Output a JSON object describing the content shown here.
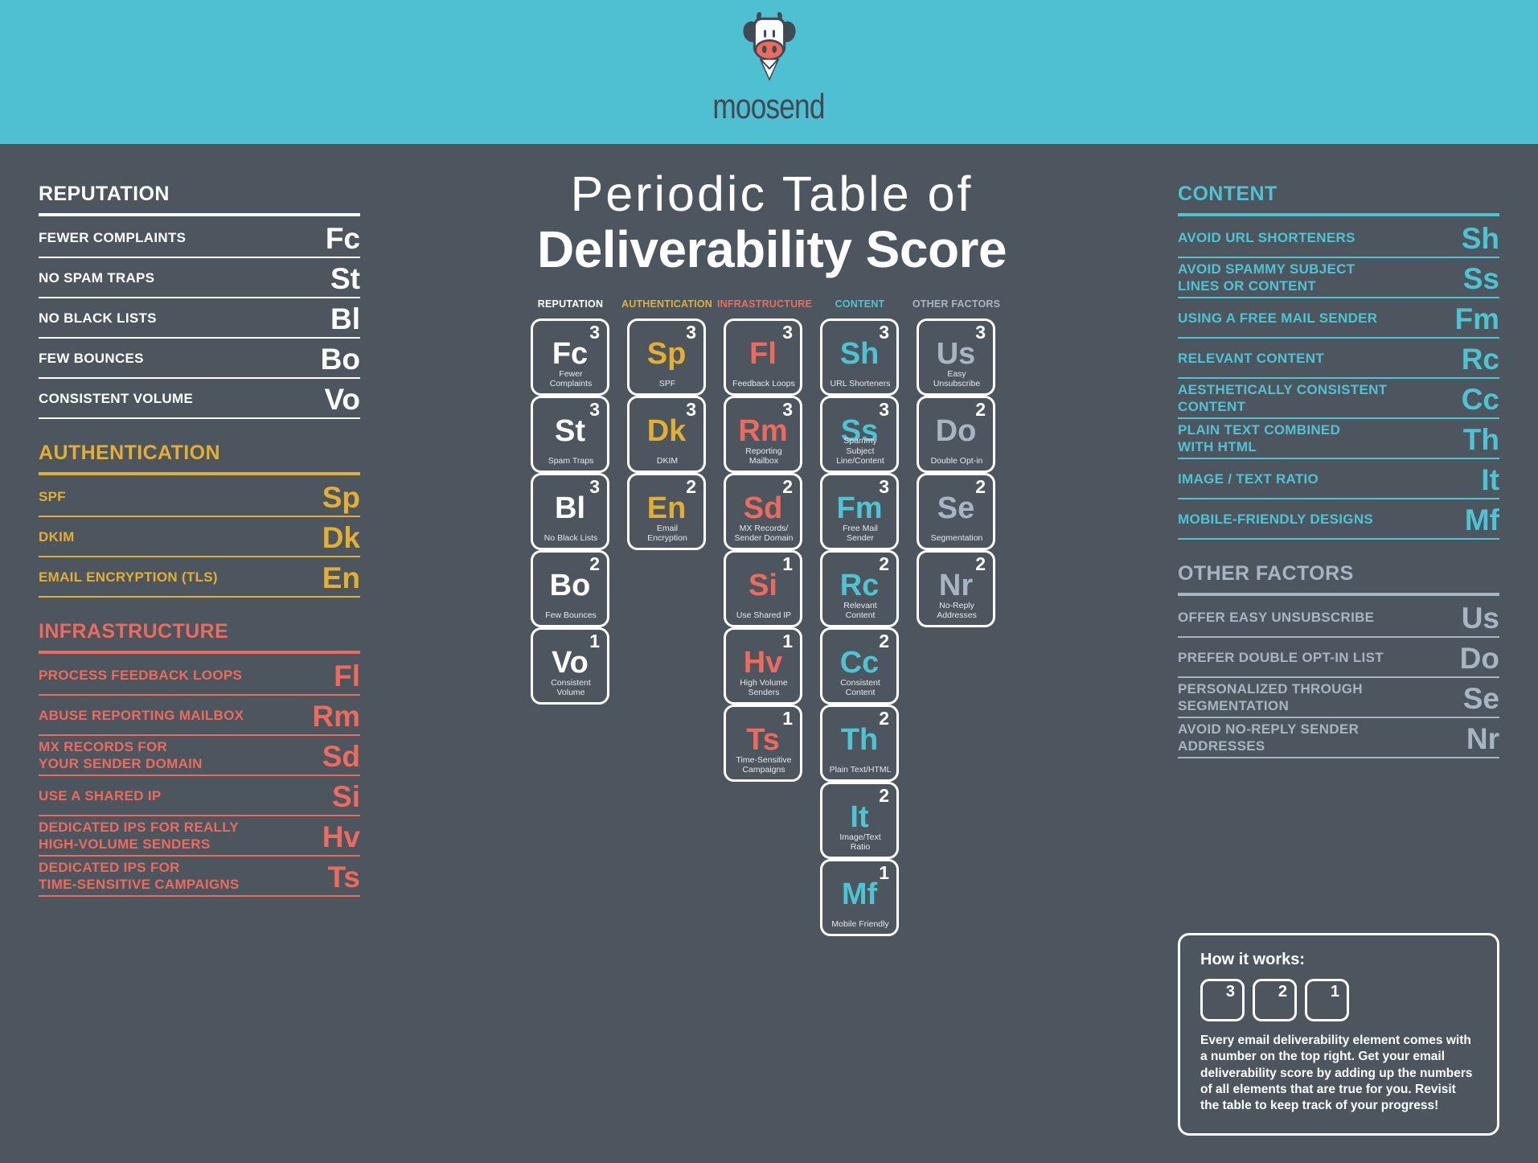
{
  "brand": {
    "name": "moosend",
    "header_bg": "#4fbfd2",
    "page_bg": "#4d565f"
  },
  "title": {
    "line1": "Periodic Table of",
    "line2": "Deliverability Score"
  },
  "colors": {
    "reputation": "#ffffff",
    "authentication": "#e3ae34",
    "infrastructure": "#ec6a5e",
    "content": "#4fc3d2",
    "other_factors": "#a7b4c2"
  },
  "left_sections": [
    {
      "heading": "REPUTATION",
      "color_key": "reputation",
      "rows": [
        {
          "label": "FEWER COMPLAINTS",
          "symbol": "Fc"
        },
        {
          "label": "NO SPAM TRAPS",
          "symbol": "St"
        },
        {
          "label": "NO BLACK LISTS",
          "symbol": "Bl"
        },
        {
          "label": "FEW BOUNCES",
          "symbol": "Bo"
        },
        {
          "label": "CONSISTENT VOLUME",
          "symbol": "Vo"
        }
      ]
    },
    {
      "heading": "AUTHENTICATION",
      "color_key": "authentication",
      "rows": [
        {
          "label": "SPF",
          "symbol": "Sp"
        },
        {
          "label": "DKIM",
          "symbol": "Dk"
        },
        {
          "label": "EMAIL ENCRYPTION (TLS)",
          "symbol": "En"
        }
      ]
    },
    {
      "heading": "INFRASTRUCTURE",
      "color_key": "infrastructure",
      "rows": [
        {
          "label": "PROCESS FEEDBACK LOOPS",
          "symbol": "Fl"
        },
        {
          "label": "ABUSE REPORTING MAILBOX",
          "symbol": "Rm"
        },
        {
          "label": "MX RECORDS FOR\nYOUR SENDER DOMAIN",
          "symbol": "Sd"
        },
        {
          "label": "USE A SHARED IP",
          "symbol": "Si"
        },
        {
          "label": "DEDICATED IPS FOR REALLY\nHIGH-VOLUME SENDERS",
          "symbol": "Hv"
        },
        {
          "label": "DEDICATED IPS FOR\nTIME-SENSITIVE CAMPAIGNS",
          "symbol": "Ts"
        }
      ]
    }
  ],
  "right_sections": [
    {
      "heading": "CONTENT",
      "color_key": "content",
      "rows": [
        {
          "label": "AVOID URL SHORTENERS",
          "symbol": "Sh"
        },
        {
          "label": "AVOID SPAMMY SUBJECT\nLINES OR CONTENT",
          "symbol": "Ss"
        },
        {
          "label": "USING A FREE MAIL SENDER",
          "symbol": "Fm"
        },
        {
          "label": "RELEVANT CONTENT",
          "symbol": "Rc"
        },
        {
          "label": "AESTHETICALLY CONSISTENT\nCONTENT",
          "symbol": "Cc"
        },
        {
          "label": "PLAIN TEXT COMBINED\nWITH HTML",
          "symbol": "Th"
        },
        {
          "label": "IMAGE / TEXT RATIO",
          "symbol": "It"
        },
        {
          "label": "MOBILE-FRIENDLY DESIGNS",
          "symbol": "Mf"
        }
      ]
    },
    {
      "heading": "OTHER FACTORS",
      "color_key": "other_factors",
      "rows": [
        {
          "label": "OFFER EASY UNSUBSCRIBE",
          "symbol": "Us"
        },
        {
          "label": "PREFER DOUBLE OPT-IN LIST",
          "symbol": "Do"
        },
        {
          "label": "PERSONALIZED THROUGH\nSEGMENTATION",
          "symbol": "Se"
        },
        {
          "label": "AVOID NO-REPLY SENDER\nADDRESSES",
          "symbol": "Nr"
        }
      ]
    }
  ],
  "periodic_table": {
    "column_headers": [
      {
        "label": "REPUTATION",
        "color_key": "reputation"
      },
      {
        "label": "AUTHENTICATION",
        "color_key": "authentication"
      },
      {
        "label": "INFRASTRUCTURE",
        "color_key": "infrastructure"
      },
      {
        "label": "CONTENT",
        "color_key": "content"
      },
      {
        "label": "OTHER FACTORS",
        "color_key": "other_factors"
      }
    ],
    "cells": [
      {
        "col": 0,
        "row": 0,
        "symbol": "Fc",
        "number": "3",
        "name": "Fewer Complaints",
        "color_key": "reputation"
      },
      {
        "col": 0,
        "row": 1,
        "symbol": "St",
        "number": "3",
        "name": "Spam Traps",
        "color_key": "reputation"
      },
      {
        "col": 0,
        "row": 2,
        "symbol": "Bl",
        "number": "3",
        "name": "No Black Lists",
        "color_key": "reputation"
      },
      {
        "col": 0,
        "row": 3,
        "symbol": "Bo",
        "number": "2",
        "name": "Few Bounces",
        "color_key": "reputation"
      },
      {
        "col": 0,
        "row": 4,
        "symbol": "Vo",
        "number": "1",
        "name": "Consistent\nVolume",
        "color_key": "reputation"
      },
      {
        "col": 1,
        "row": 0,
        "symbol": "Sp",
        "number": "3",
        "name": "SPF",
        "color_key": "authentication"
      },
      {
        "col": 1,
        "row": 1,
        "symbol": "Dk",
        "number": "3",
        "name": "DKIM",
        "color_key": "authentication"
      },
      {
        "col": 1,
        "row": 2,
        "symbol": "En",
        "number": "2",
        "name": "Email Encryption",
        "color_key": "authentication"
      },
      {
        "col": 2,
        "row": 0,
        "symbol": "Fl",
        "number": "3",
        "name": "Feedback Loops",
        "color_key": "infrastructure"
      },
      {
        "col": 2,
        "row": 1,
        "symbol": "Rm",
        "number": "3",
        "name": "Reporting Mailbox",
        "color_key": "infrastructure"
      },
      {
        "col": 2,
        "row": 2,
        "symbol": "Sd",
        "number": "2",
        "name": "MX Records/\nSender Domain",
        "color_key": "infrastructure"
      },
      {
        "col": 2,
        "row": 3,
        "symbol": "Si",
        "number": "1",
        "name": "Use Shared IP",
        "color_key": "infrastructure"
      },
      {
        "col": 2,
        "row": 4,
        "symbol": "Hv",
        "number": "1",
        "name": "High Volume\nSenders",
        "color_key": "infrastructure"
      },
      {
        "col": 2,
        "row": 5,
        "symbol": "Ts",
        "number": "1",
        "name": "Time-Sensitive\nCampaigns",
        "color_key": "infrastructure"
      },
      {
        "col": 3,
        "row": 0,
        "symbol": "Sh",
        "number": "3",
        "name": "URL Shorteners",
        "color_key": "content"
      },
      {
        "col": 3,
        "row": 1,
        "symbol": "Ss",
        "number": "3",
        "name": "Spammy Subject\nLine/Content",
        "color_key": "content"
      },
      {
        "col": 3,
        "row": 2,
        "symbol": "Fm",
        "number": "3",
        "name": "Free Mail Sender",
        "color_key": "content"
      },
      {
        "col": 3,
        "row": 3,
        "symbol": "Rc",
        "number": "2",
        "name": "Relevant Content",
        "color_key": "content"
      },
      {
        "col": 3,
        "row": 4,
        "symbol": "Cc",
        "number": "2",
        "name": "Consistent\nContent",
        "color_key": "content"
      },
      {
        "col": 3,
        "row": 5,
        "symbol": "Th",
        "number": "2",
        "name": "Plain Text/HTML",
        "color_key": "content"
      },
      {
        "col": 3,
        "row": 6,
        "symbol": "It",
        "number": "2",
        "name": "Image/Text Ratio",
        "color_key": "content"
      },
      {
        "col": 3,
        "row": 7,
        "symbol": "Mf",
        "number": "1",
        "name": "Mobile Friendly",
        "color_key": "content"
      },
      {
        "col": 4,
        "row": 0,
        "symbol": "Us",
        "number": "3",
        "name": "Easy\nUnsubscribe",
        "color_key": "other_factors"
      },
      {
        "col": 4,
        "row": 1,
        "symbol": "Do",
        "number": "2",
        "name": "Double Opt-in",
        "color_key": "other_factors"
      },
      {
        "col": 4,
        "row": 2,
        "symbol": "Se",
        "number": "2",
        "name": "Segmentation",
        "color_key": "other_factors"
      },
      {
        "col": 4,
        "row": 3,
        "symbol": "Nr",
        "number": "2",
        "name": "No-Reply\nAddresses",
        "color_key": "other_factors"
      }
    ]
  },
  "how_it_works": {
    "title": "How it works:",
    "chips": [
      "3",
      "2",
      "1"
    ],
    "body": "Every email deliverability element comes with a number on the top right. Get your email deliverability score by adding up the numbers of all elements that are true for you. Revisit the table to keep track of your progress!"
  }
}
